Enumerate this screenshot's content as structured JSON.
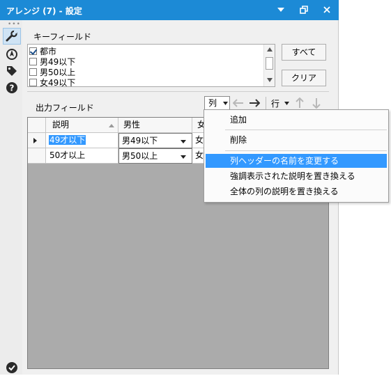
{
  "window": {
    "title": "アレンジ (7) - 設定",
    "dropdown_icon": "caret-down-icon",
    "restore_icon": "restore-icon",
    "close_icon": "close-icon"
  },
  "toolbar_left": [
    "wrench-icon",
    "target-icon",
    "tag-icon",
    "help-icon",
    "checkmark-icon"
  ],
  "key_field": {
    "label": "キーフィールド",
    "items": [
      {
        "label": "都市",
        "checked": true
      },
      {
        "label": "男49以下",
        "checked": false
      },
      {
        "label": "男50以上",
        "checked": false
      },
      {
        "label": "女49以下",
        "checked": false
      }
    ],
    "select_all": "すべて",
    "clear": "クリア"
  },
  "output": {
    "label": "出力フィールド",
    "column_button": "列",
    "row_button": "行"
  },
  "grid": {
    "headers": [
      "説明",
      "男性",
      "女"
    ],
    "rows": [
      {
        "desc": "49才以下",
        "male": "男49以下",
        "female": "女"
      },
      {
        "desc": "50才以上",
        "male": "男50以上",
        "female": "女"
      }
    ]
  },
  "menu": {
    "items": [
      "追加",
      "削除",
      "列ヘッダーの名前を変更する",
      "強調表示された説明を置き換える",
      "全体の列の説明を置き換える"
    ],
    "selected": "列ヘッダーの名前を変更する"
  }
}
